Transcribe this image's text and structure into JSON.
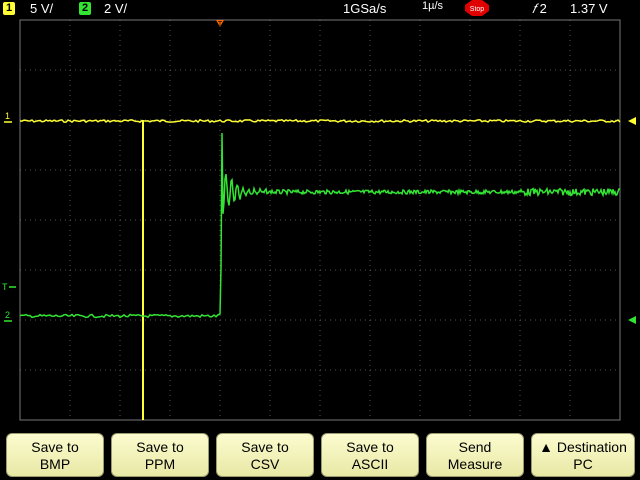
{
  "status_bar": {
    "ch1_badge": "1",
    "ch1_scale": "5 V/",
    "ch2_badge": "2",
    "ch2_scale": "2 V/",
    "sample_rate": "1GSa/s",
    "acq_mode": "1µ/s",
    "stop_label": "Stop",
    "trigger_source": "2",
    "trigger_level": "1.37 V"
  },
  "markers": {
    "ch1_marker": "1",
    "ch2_marker": "2",
    "trigger_level_marker": "T",
    "trigger_position_marker": "T"
  },
  "colors": {
    "ch1": "#ffff33",
    "ch2": "#33e533",
    "grid": "#555555",
    "trigger": "#ff6a00"
  },
  "softkeys": [
    {
      "line1": "Save to",
      "line2": "BMP"
    },
    {
      "line1": "Save to",
      "line2": "PPM"
    },
    {
      "line1": "Save to",
      "line2": "CSV"
    },
    {
      "line1": "Save to",
      "line2": "ASCII"
    },
    {
      "line1": "Send",
      "line2": "Measure"
    },
    {
      "line1": "▲ Destination",
      "line2": "PC"
    }
  ]
}
